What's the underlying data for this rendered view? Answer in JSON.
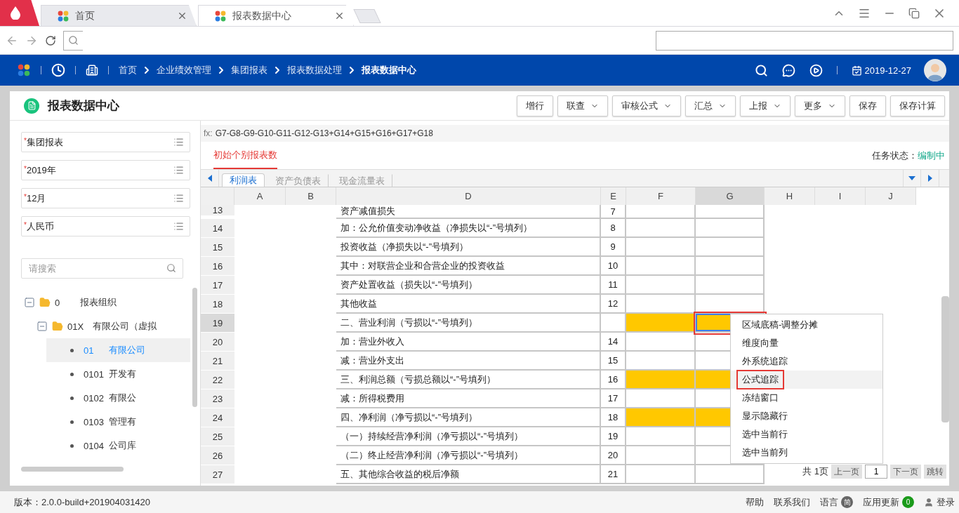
{
  "browser": {
    "tabs": [
      {
        "label": "首页",
        "selected": false
      },
      {
        "label": "报表数据中心",
        "selected": true
      }
    ]
  },
  "nav": {
    "breadcrumbs": [
      {
        "label": "首页",
        "current": false
      },
      {
        "label": "企业绩效管理",
        "current": false
      },
      {
        "label": "集团报表",
        "current": false
      },
      {
        "label": "报表数据处理",
        "current": false
      },
      {
        "label": "报表数据中心",
        "current": true
      }
    ],
    "date": "2019-12-27"
  },
  "page": {
    "title": "报表数据中心",
    "buttons": [
      {
        "label": "增行",
        "dropdown": false
      },
      {
        "label": "联查",
        "dropdown": true
      },
      {
        "label": "审核公式",
        "dropdown": true
      },
      {
        "label": "汇总",
        "dropdown": true
      },
      {
        "label": "上报",
        "dropdown": true
      },
      {
        "label": "更多",
        "dropdown": true
      },
      {
        "label": "保存",
        "dropdown": false
      },
      {
        "label": "保存计算",
        "dropdown": false
      }
    ]
  },
  "filters": [
    {
      "mark": "*",
      "value": "集团报表"
    },
    {
      "mark": "*",
      "value": "2019年"
    },
    {
      "mark": "*",
      "value": "12月"
    },
    {
      "mark": "*",
      "value": "人民币"
    }
  ],
  "search": {
    "placeholder": "请搜索"
  },
  "tree": [
    {
      "code": "0",
      "name": "报表组织",
      "expanded": true,
      "selected": false,
      "children": [
        {
          "code": "01X",
          "name": "有限公司（虚拟",
          "expanded": true,
          "selected": false,
          "children": [
            {
              "code": "01",
              "name": "有限公司",
              "selected": true
            },
            {
              "code": "0101",
              "name": "开发有",
              "selected": false
            },
            {
              "code": "0102",
              "name": "有限公",
              "selected": false
            },
            {
              "code": "0103",
              "name": "管理有",
              "selected": false
            },
            {
              "code": "0104",
              "name": "公司库",
              "selected": false
            }
          ]
        }
      ]
    }
  ],
  "formula": {
    "label": "fx:",
    "text": "G7-G8-G9-G10-G11-G12-G13+G14+G15+G16+G17+G18"
  },
  "report_tabs": [
    {
      "label": "初始个别报表数",
      "selected": true
    }
  ],
  "task_status": {
    "label": "任务状态：",
    "value": "编制中"
  },
  "sheet_tabs": [
    {
      "label": "利润表",
      "selected": true
    },
    {
      "label": "资产负债表",
      "selected": false
    },
    {
      "label": "现金流量表",
      "selected": false
    }
  ],
  "grid": {
    "columns": [
      {
        "label": "A",
        "selected": false
      },
      {
        "label": "B",
        "selected": false
      },
      {
        "label": "D",
        "selected": false
      },
      {
        "label": "E",
        "selected": false
      },
      {
        "label": "F",
        "selected": false
      },
      {
        "label": "G",
        "selected": true
      },
      {
        "label": "H",
        "selected": false
      },
      {
        "label": "I",
        "selected": false
      },
      {
        "label": "J",
        "selected": false
      }
    ],
    "rows": [
      {
        "number": "13",
        "item": "资产减值损失",
        "line": "7",
        "filled": false,
        "selected": false
      },
      {
        "number": "14",
        "item": "加：公允价值变动净收益（净损失以“-”号填列）",
        "line": "8",
        "filled": false,
        "selected": false
      },
      {
        "number": "15",
        "item": "投资收益（净损失以“-”号填列）",
        "line": "9",
        "filled": false,
        "selected": false
      },
      {
        "number": "16",
        "item": "其中：对联营企业和合营企业的投资收益",
        "line": "10",
        "filled": false,
        "selected": false
      },
      {
        "number": "17",
        "item": "资产处置收益（损失以“-”号填列）",
        "line": "11",
        "filled": false,
        "selected": false
      },
      {
        "number": "18",
        "item": "其他收益",
        "line": "12",
        "filled": false,
        "selected": false
      },
      {
        "number": "19",
        "item": "二、营业利润（亏损以“-”号填列）",
        "filled": true,
        "selected": true
      },
      {
        "number": "20",
        "item": "加：营业外收入",
        "line": "14",
        "filled": false,
        "selected": false
      },
      {
        "number": "21",
        "item": "减：营业外支出",
        "line": "15",
        "filled": false,
        "selected": false
      },
      {
        "number": "22",
        "item": "三、利润总额（亏损总额以“-”号填列）",
        "line": "16",
        "filled": true,
        "selected": false
      },
      {
        "number": "23",
        "item": "减：所得税费用",
        "line": "17",
        "filled": false,
        "selected": false
      },
      {
        "number": "24",
        "item": "四、净利润（净亏损以“-”号填列）",
        "line": "18",
        "filled": true,
        "selected": false
      },
      {
        "number": "25",
        "item": "（一）持续经营净利润（净亏损以“-”号填列）",
        "line": "19",
        "filled": false,
        "selected": false
      },
      {
        "number": "26",
        "item": "（二）终止经营净利润（净亏损以“-”号填列）",
        "line": "20",
        "filled": false,
        "selected": false
      },
      {
        "number": "27",
        "item": "五、其他综合收益的税后净额",
        "line": "21",
        "filled": false,
        "selected": false
      }
    ]
  },
  "context_menu": [
    {
      "label": "区域底稿-调整分摊",
      "selected": false
    },
    {
      "label": "维度向量",
      "selected": false
    },
    {
      "label": "外系统追踪",
      "selected": false
    },
    {
      "label": "公式追踪",
      "selected": true
    },
    {
      "label": "冻结窗口",
      "selected": false
    },
    {
      "label": "显示隐藏行",
      "selected": false
    },
    {
      "label": "选中当前行",
      "selected": false
    },
    {
      "label": "选中当前列",
      "selected": false
    }
  ],
  "pagination": {
    "summary": "共 1页",
    "prev": "上一页",
    "page": "1",
    "next": "下一页",
    "go": "跳转"
  },
  "status_bar": {
    "version": "版本：2.0.0-build+201904031420",
    "links": [
      {
        "kind": "plain",
        "label": "帮助"
      },
      {
        "kind": "plain",
        "label": "联系我们"
      },
      {
        "kind": "language",
        "label": "语言",
        "badge": "简"
      },
      {
        "kind": "update",
        "label": "应用更新",
        "badge": "0"
      },
      {
        "kind": "user",
        "label": "登录"
      }
    ]
  }
}
